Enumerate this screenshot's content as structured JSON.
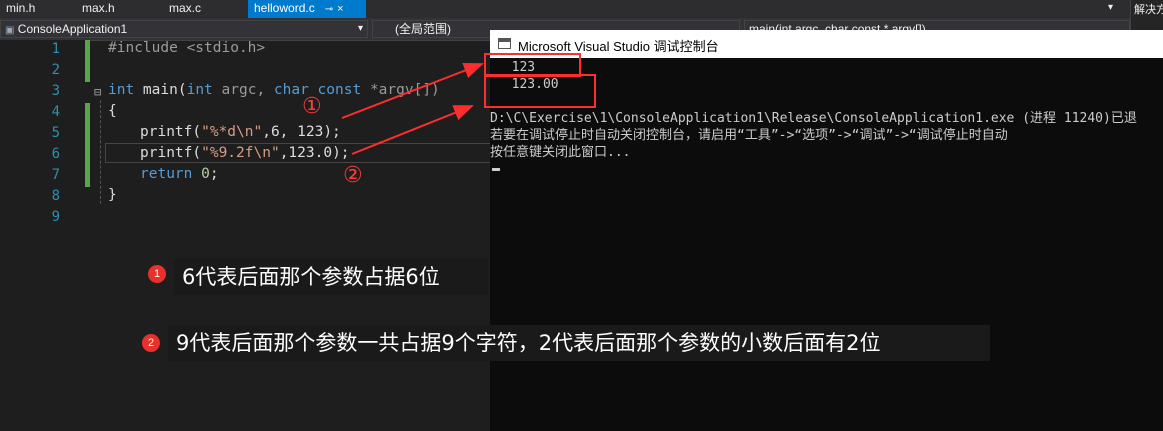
{
  "tabs": [
    {
      "label": "min.h"
    },
    {
      "label": "max.h"
    },
    {
      "label": "max.c"
    },
    {
      "label": "helloword.c",
      "pin": "⊸",
      "close": "×"
    }
  ],
  "navbar": {
    "project": "ConsoleApplication1",
    "scope": "(全局范围)",
    "function": "main(int argc, char const * argv[])"
  },
  "right_panel": {
    "label": "解决方"
  },
  "line_numbers": [
    "1",
    "2",
    "3",
    "4",
    "5",
    "6",
    "7",
    "8",
    "9"
  ],
  "code": {
    "line1": "#include <stdio.h>",
    "line3_kw1": "int",
    "line3_rest": " main(",
    "line3_kw2": "int",
    "line3_p1": " argc, ",
    "line3_kw3": "char",
    "line3_kw4": " const",
    "line3_p2": " *argv[])",
    "line4": "{",
    "line5_fn": "printf(",
    "line5_str": "\"%*d\\n\"",
    "line5_rest": ",6, 123);",
    "line6_fn": "printf(",
    "line6_str": "\"%9.2f\\n\"",
    "line6_rest": ",123.0);",
    "line7_kw": "return",
    "line7_num": " 0",
    "line7_end": ";",
    "line8": "}"
  },
  "console": {
    "title": "Microsoft Visual Studio 调试控制台",
    "out1": "  123",
    "out2": "  123.00",
    "info1": "D:\\C\\Exercise\\1\\ConsoleApplication1\\Release\\ConsoleApplication1.exe (进程 11240)已退",
    "info2": "若要在调试停止时自动关闭控制台，请启用“工具”->“选项”->“调试”->“调试停止时自动",
    "info3": "按任意键关闭此窗口..."
  },
  "annotations": {
    "marker1": "①",
    "marker2": "②",
    "dot1": "1",
    "dot2": "2",
    "note1": "6代表后面那个参数占据6位",
    "note2": "9代表后面那个参数一共占据9个字符，2代表后面那个参数的小数后面有2位"
  },
  "colors": {
    "accent_tab": "#007acc",
    "annotation_red": "#ff2d2d",
    "editor_bg": "#1e1e1e",
    "console_bg": "#0c0c0c"
  }
}
